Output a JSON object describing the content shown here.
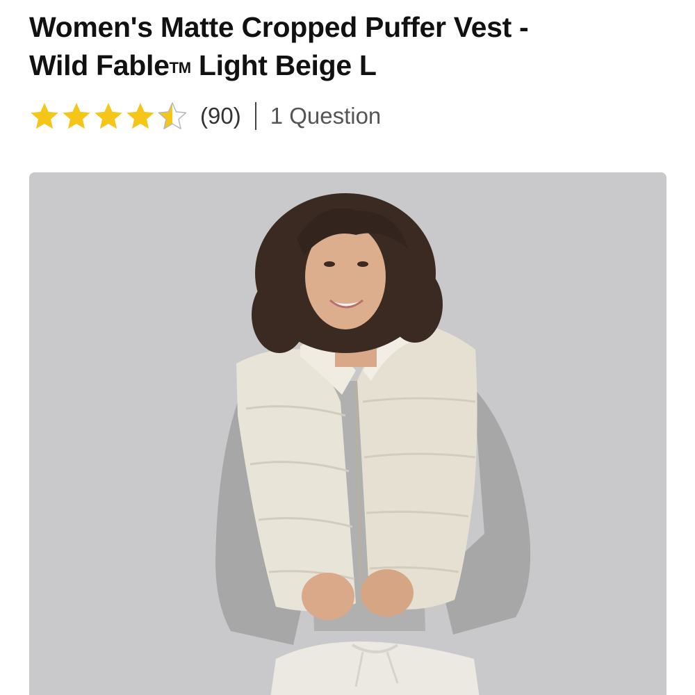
{
  "product": {
    "title_line1": "Women's Matte Cropped Puffer Vest -",
    "title_brand": "Wild Fable",
    "title_tm": "TM",
    "title_rest": " Light Beige L"
  },
  "rating": {
    "value": 4.5,
    "max": 5,
    "review_count": "(90)",
    "questions": "1 Question",
    "star_color": "#f5c518"
  },
  "image": {
    "subject": "model-wearing-cropped-puffer-vest",
    "background_color": "#c9c9cb",
    "vest_color": "#e9e4d8",
    "sweater_color": "#a9a9a9"
  }
}
